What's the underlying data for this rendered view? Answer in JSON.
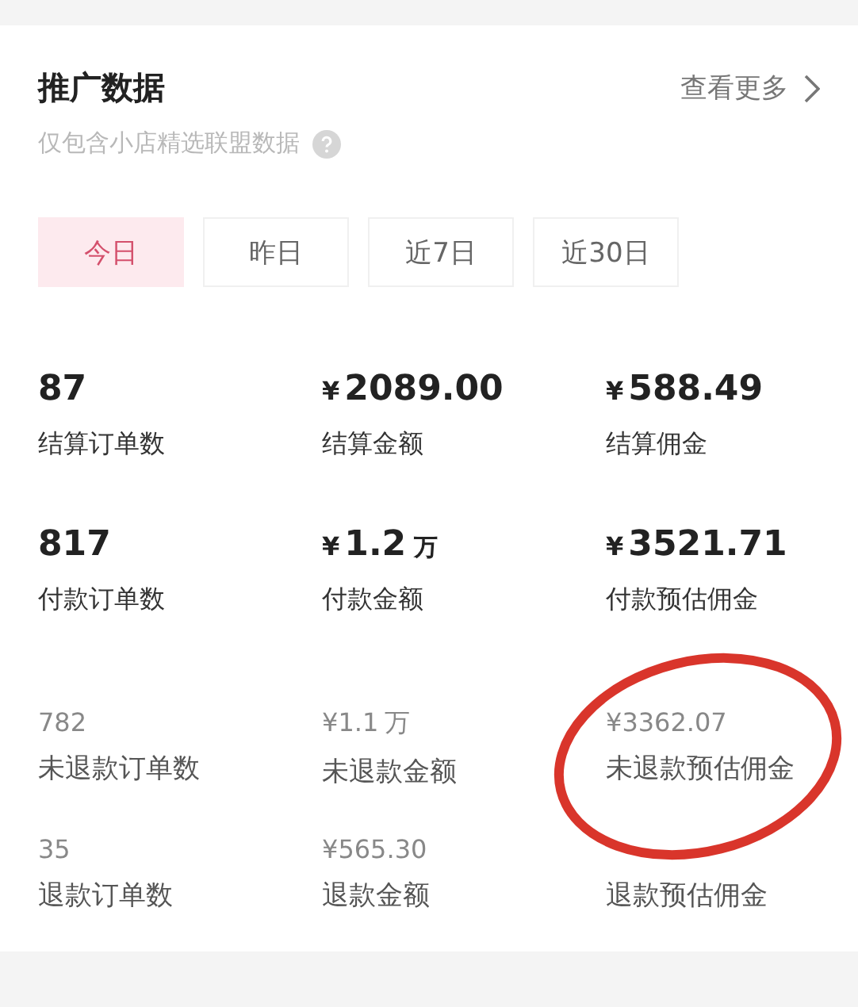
{
  "header": {
    "title": "推广数据",
    "more_link": "查看更多",
    "subtitle": "仅包含小店精选联盟数据"
  },
  "tabs": [
    {
      "label": "今日",
      "selected": true
    },
    {
      "label": "昨日",
      "selected": false
    },
    {
      "label": "近7日",
      "selected": false
    },
    {
      "label": "近30日",
      "selected": false
    }
  ],
  "metric_rows": [
    {
      "kind": "major",
      "items": [
        {
          "number": "87",
          "label": "结算订单数"
        },
        {
          "currency": "¥",
          "number": "2089.00",
          "label": "结算金额"
        },
        {
          "currency": "¥",
          "number": "588.49",
          "label": "结算佣金"
        }
      ]
    },
    {
      "kind": "major",
      "items": [
        {
          "number": "817",
          "label": "付款订单数"
        },
        {
          "currency": "¥",
          "number": "1.2",
          "unit": "万",
          "label": "付款金额"
        },
        {
          "currency": "¥",
          "number": "3521.71",
          "label": "付款预估佣金"
        }
      ]
    },
    {
      "kind": "minor",
      "items": [
        {
          "number": "782",
          "label": "未退款订单数"
        },
        {
          "currency": "¥",
          "number": "1.1",
          "unit": "万",
          "label": "未退款金额"
        },
        {
          "currency": "¥",
          "number": "3362.07",
          "label": "未退款预估佣金"
        }
      ]
    },
    {
      "kind": "minor",
      "items": [
        {
          "number": "35",
          "label": "退款订单数"
        },
        {
          "currency": "¥",
          "number": "565.30",
          "label": "退款金额"
        },
        {
          "label": "退款预估佣金"
        }
      ]
    }
  ]
}
